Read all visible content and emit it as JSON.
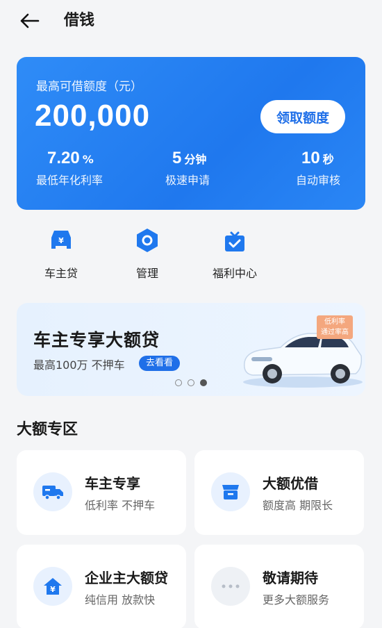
{
  "header": {
    "title": "借钱",
    "back_icon": "arrow-left-icon"
  },
  "quota_card": {
    "label": "最高可借额度（元）",
    "amount": "200,000",
    "claim_button": "领取额度",
    "stats": [
      {
        "value": "7.20",
        "unit": "%",
        "label": "最低年化利率"
      },
      {
        "value": "5",
        "unit": "分钟",
        "label": "极速申请"
      },
      {
        "value": "10",
        "unit": "秒",
        "label": "自动审核"
      }
    ],
    "colors": {
      "accent": "#1f78ee"
    }
  },
  "shortcuts": [
    {
      "label": "车主贷",
      "icon": "car-loan-icon"
    },
    {
      "label": "管理",
      "icon": "manage-icon"
    },
    {
      "label": "福利中心",
      "icon": "gift-icon"
    }
  ],
  "banner": {
    "title": "车主专享大额贷",
    "subtitle": "最高100万 不押车",
    "button": "去看看",
    "tag_line1": "低利率",
    "tag_line2": "通过率高",
    "page_count": 3,
    "active_page": 3
  },
  "section": {
    "title": "大额专区"
  },
  "tiles": [
    {
      "title": "车主专享",
      "subtitle": "低利率 不押车",
      "icon": "truck-icon"
    },
    {
      "title": "大额优借",
      "subtitle": "额度高 期限长",
      "icon": "store-icon"
    },
    {
      "title": "企业主大额贷",
      "subtitle": "纯信用 放款快",
      "icon": "house-yen-icon"
    },
    {
      "title": "敬请期待",
      "subtitle": "更多大额服务",
      "icon": "more-dots-icon"
    }
  ]
}
